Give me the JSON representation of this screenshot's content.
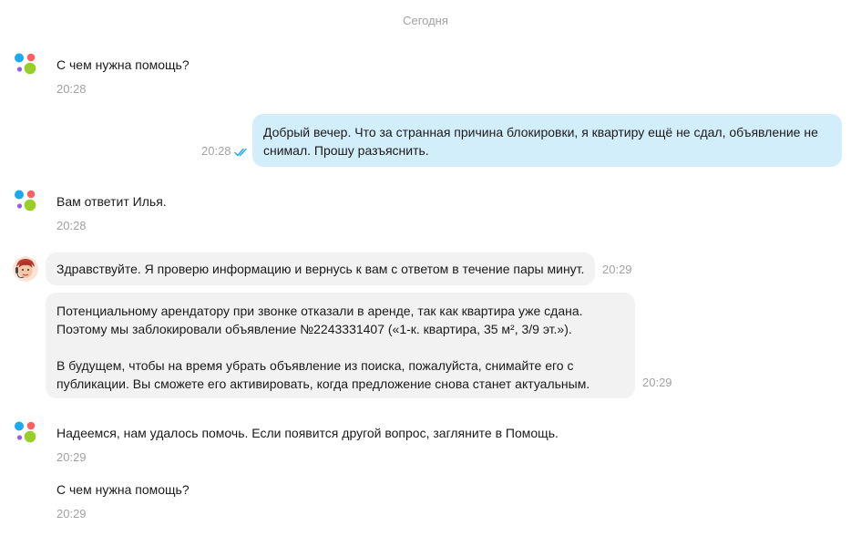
{
  "date_separator": "Сегодня",
  "messages": [
    {
      "text": "С чем нужна помощь?",
      "time": "20:28"
    },
    {
      "text": "Добрый вечер. Что за странная причина блокировки, я квартиру ещё не сдал, объявление не снимал. Прошу разъяснить.",
      "time": "20:28"
    },
    {
      "text": "Вам ответит Илья.",
      "time": "20:28"
    },
    {
      "text": "Здравствуйте. Я проверю информацию и вернусь к вам с ответом в течение пары минут.",
      "time": "20:29"
    },
    {
      "paragraph1": "Потенциальному арендатору при звонке отказали в аренде, так как  квартира уже сдана. Поэтому мы заблокировали объявление №2243331407 («1-к. квартира, 35 м², 3/9 эт.»).",
      "paragraph2": "В будущем, чтобы на время убрать объявление из поиска, пожалуйста, снимайте его с публикации. Вы сможете его активировать, когда предложение снова станет актуальным.",
      "time": "20:29"
    },
    {
      "text": "Надеемся, нам удалось помочь. Если появится другой вопрос, загляните в Помощь.",
      "time": "20:29"
    },
    {
      "text": "С чем нужна помощь?",
      "time": "20:29"
    }
  ],
  "colors": {
    "outgoing_bubble": "#d3eefb",
    "incoming_bubble": "#f2f2f2",
    "logo_blue": "#1aaaf0",
    "logo_red": "#ff6163",
    "logo_purple": "#965eeb",
    "logo_green": "#97cf26",
    "read_check": "#1aaaf0"
  },
  "icons": {
    "bot_avatar": "avito-logo-icon",
    "agent_avatar": "agent-avatar-icon",
    "read_status": "double-check-icon"
  }
}
